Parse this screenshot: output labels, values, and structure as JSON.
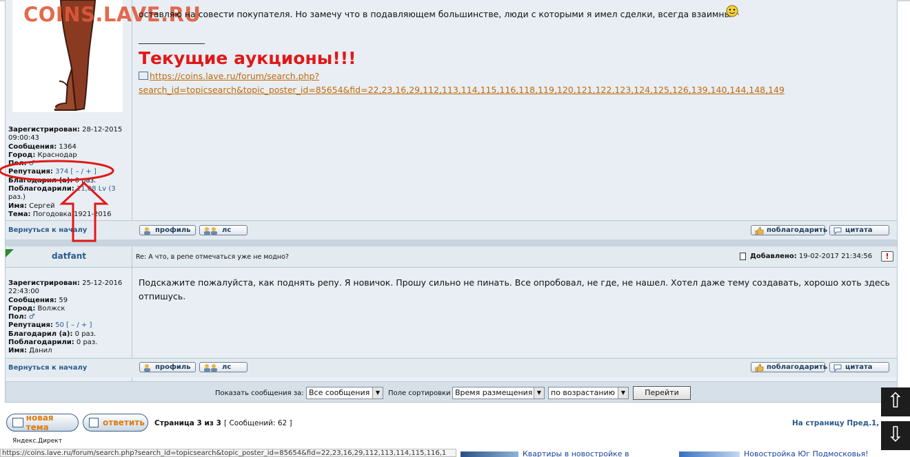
{
  "watermark": "COINS.LAVE.RU",
  "post1": {
    "text_line": "оставляю на совести покупателя. Но замечу что в подавляющем большинстве, люди с которыми я имел сделки, всегда взаимны",
    "separator": "________________",
    "auctions_title": "Текущие аукционы!!!",
    "link_line1": "https://coins.lave.ru/forum/search.php?",
    "link_line2": "search_id=topicsearch&topic_poster_id=85654&fid=22,23,16,29,112,113,114,115,116,118,119,120,121,122,123,124,125,126,139,140,144,148,149",
    "author": {
      "registered_label": "Зарегистрирован:",
      "registered_value": "28-12-2015",
      "registered_time": "09:00:43",
      "messages_label": "Сообщения:",
      "messages_value": "1364",
      "city_label": "Город:",
      "city_value": "Краснодар",
      "sex_label": "Пол:",
      "rep_label": "Репутация:",
      "rep_value": "374",
      "rep_open": "[",
      "rep_minus": "–",
      "rep_slash": "/",
      "rep_plus": "+",
      "rep_close": "]",
      "thanked_label": "Благодарил (а):",
      "thanked_value": "0 раз.",
      "got_thanks_label": "Поблагодарили:",
      "got_thanks_value": "11,08 Lv (3",
      "got_thanks_value2": "раз.)",
      "name_label": "Имя:",
      "name_value": "Сергей",
      "topic_label": "Тема:",
      "topic_value": "Погодовка 1921-2016"
    }
  },
  "post2": {
    "author_name": "datfant",
    "subject": "Re: А что, в репе отмечаться уже не модно?",
    "added_label": "Добавлено:",
    "added_value": "19-02-2017 21:34:56",
    "message": "Подскажите пожалуйста, как поднять репу. Я новичок. Прошу сильно не пинать. Все опробовал, не где, не нашел. Хотел даже тему создавать, хорошо хоть здесь",
    "message2": "отпишусь.",
    "author": {
      "registered_label": "Зарегистрирован:",
      "registered_value": "25-12-2016",
      "registered_time": "22:43:00",
      "messages_label": "Сообщения:",
      "messages_value": "59",
      "city_label": "Город:",
      "city_value": "Волжск",
      "sex_label": "Пол:",
      "rep_label": "Репутация:",
      "rep_value": "50",
      "rep_open": "[",
      "rep_minus": "–",
      "rep_slash": "/",
      "rep_plus": "+",
      "rep_close": "]",
      "thanked_label": "Благодарил (а):",
      "thanked_value": "0 раз.",
      "got_thanks_label": "Поблагодарили:",
      "got_thanks_value": "0 раз.",
      "name_label": "Имя:",
      "name_value": "Данил"
    }
  },
  "buttons": {
    "back_to_top": "Вернуться к началу",
    "profile": "профиль",
    "pm": "лс",
    "thank": "поблагодарить",
    "quote": "цитата"
  },
  "filters": {
    "show_label": "Показать сообщения за:",
    "show_value": "Все сообщения",
    "sort_label": "Поле сортировки",
    "sort_value": "Время размещения",
    "order_value": "по возрастанию",
    "go_label": "Перейти"
  },
  "pagination": {
    "new_topic": "новая тема",
    "reply": "ответить",
    "page_info": "Страница 3 из 3",
    "messages_count": "[ Сообщений: 62 ]",
    "goto_label": "На страницу Пред.",
    "goto_page": "1,"
  },
  "footer": {
    "yandex": "Яндекс.Директ",
    "status_url": "https://coins.lave.ru/forum/search.php?search_id=topicsearch&topic_poster_id=85654&fid=22,23,16,29,112,113,114,115,116,1",
    "ad1": "Квартиры в новостройке в",
    "ad2": "Новостройка Юг Подмосковья!"
  },
  "scroll": {
    "up": "⇧",
    "down": "⇩"
  },
  "colors": {
    "annotation": "#e01818",
    "link": "#c06a0a",
    "heading_red": "#e01818"
  }
}
